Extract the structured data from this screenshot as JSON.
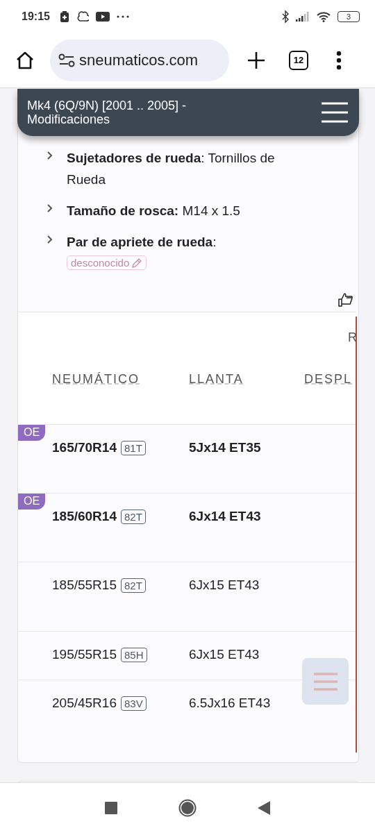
{
  "status_bar": {
    "time": "19:15",
    "battery": "3"
  },
  "browser": {
    "url": "sneumaticos.com",
    "tab_count": "12"
  },
  "header": {
    "title": "Mk4 (6Q/9N) [2001 .. 2005] - Modificaciones"
  },
  "specs": [
    {
      "label": "Sujetadores de rueda",
      "value": ": Tornillos de Rueda"
    },
    {
      "label": "Tamaño de rosca:",
      "value": " M14 x 1.5"
    },
    {
      "label": "Par de apriete de rueda",
      "value": ":",
      "tag": "desconocido"
    }
  ],
  "table": {
    "group_header": "R",
    "columns": [
      "NEUMÁTICO",
      "LLANTA",
      "DESPL"
    ],
    "rows": [
      {
        "oe": "OE",
        "tire": "165/70R14",
        "load": "81T",
        "rim": "5Jx14 ET35"
      },
      {
        "oe": "OE",
        "tire": "185/60R14",
        "load": "82T",
        "rim": "6Jx14 ET43"
      },
      {
        "tire": "185/55R15",
        "load": "82T",
        "rim": "6Jx15 ET43"
      },
      {
        "tire": "195/55R15",
        "load": "85H",
        "rim": "6Jx15 ET43"
      },
      {
        "tire": "205/45R16",
        "load": "83V",
        "rim": "6.5Jx16 ET43"
      }
    ]
  }
}
